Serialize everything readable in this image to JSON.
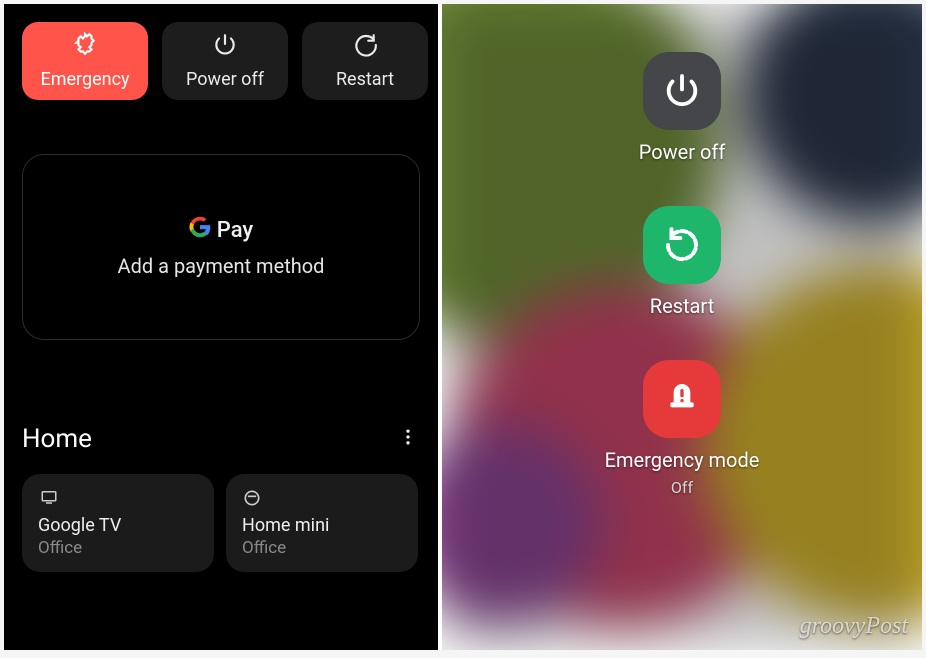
{
  "left": {
    "buttons": {
      "emergency": "Emergency",
      "power_off": "Power off",
      "restart": "Restart"
    },
    "card": {
      "logo_text": "Pay",
      "subtitle": "Add a payment method"
    },
    "home": {
      "title": "Home",
      "devices": [
        {
          "name": "Google TV",
          "room": "Office",
          "icon": "tv"
        },
        {
          "name": "Home mini",
          "room": "Office",
          "icon": "speaker"
        }
      ]
    }
  },
  "right": {
    "items": {
      "power_off": {
        "label": "Power off"
      },
      "restart": {
        "label": "Restart"
      },
      "emergency": {
        "label": "Emergency mode",
        "sub": "Off"
      }
    }
  },
  "watermark": "groovyPost"
}
